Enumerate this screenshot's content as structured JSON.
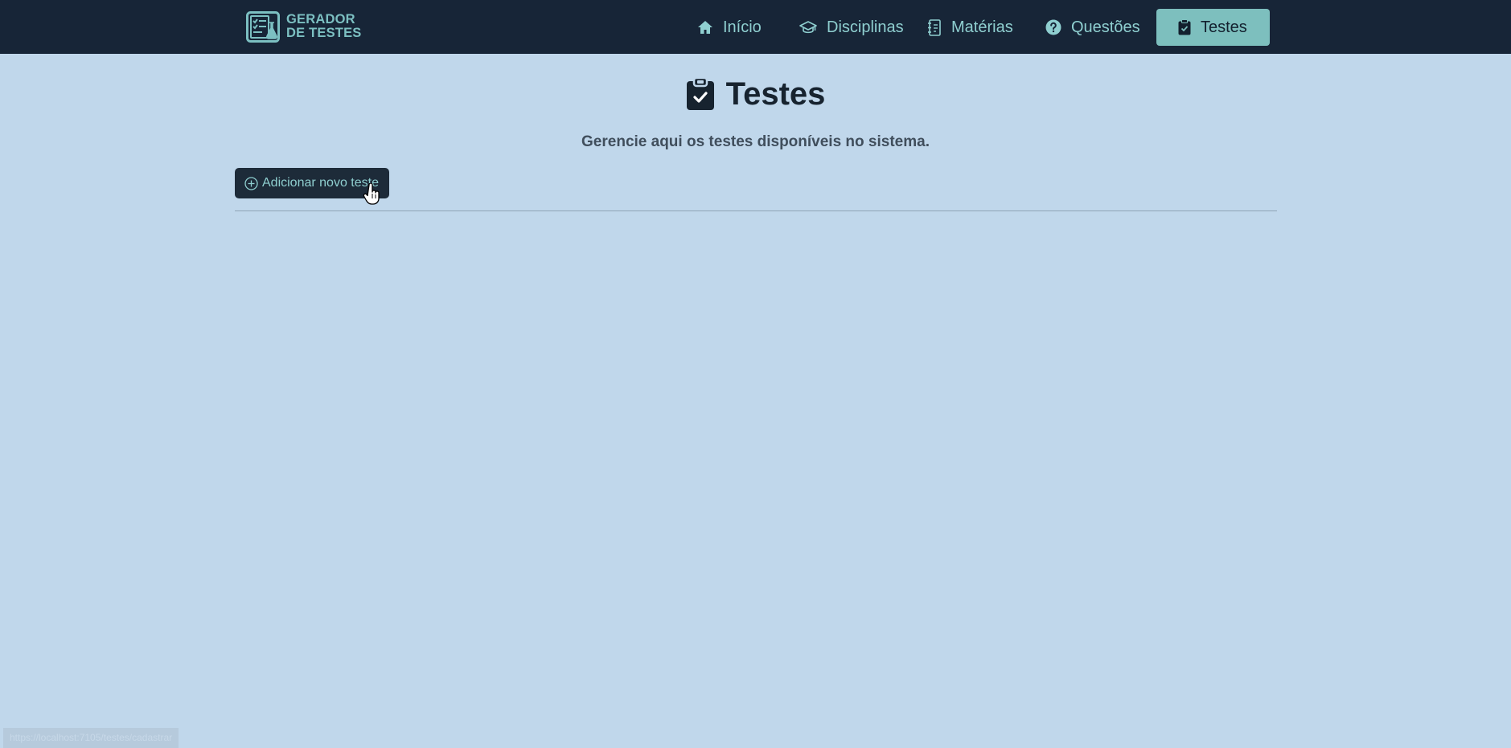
{
  "brand": {
    "line1": "GERADOR",
    "line2": "DE TESTES",
    "logo_icon": "test-generator-logo-icon"
  },
  "nav": {
    "items": [
      {
        "label": "Início",
        "icon": "home-icon",
        "active": false
      },
      {
        "label": "Disciplinas",
        "icon": "graduation-cap-icon",
        "active": false
      },
      {
        "label": "Matérias",
        "icon": "notebook-icon",
        "active": false
      },
      {
        "label": "Questões",
        "icon": "question-circle-icon",
        "active": false
      },
      {
        "label": "Testes",
        "icon": "clipboard-check-icon",
        "active": true
      }
    ]
  },
  "main": {
    "title": "Testes",
    "title_icon": "clipboard-check-icon",
    "subtitle": "Gerencie aqui os testes disponíveis no sistema.",
    "add_button_label": "Adicionar novo teste",
    "add_button_icon": "plus-circle-icon"
  },
  "status_bar": {
    "url": "https://localhost:7105/testes/cadastrar"
  },
  "colors": {
    "navbar_bg": "#172537",
    "page_bg": "#c0d7eb",
    "accent": "#7dbfbe",
    "nav_text": "#8fcfd0",
    "button_bg": "#1d2b39",
    "title_text": "#17232f"
  }
}
